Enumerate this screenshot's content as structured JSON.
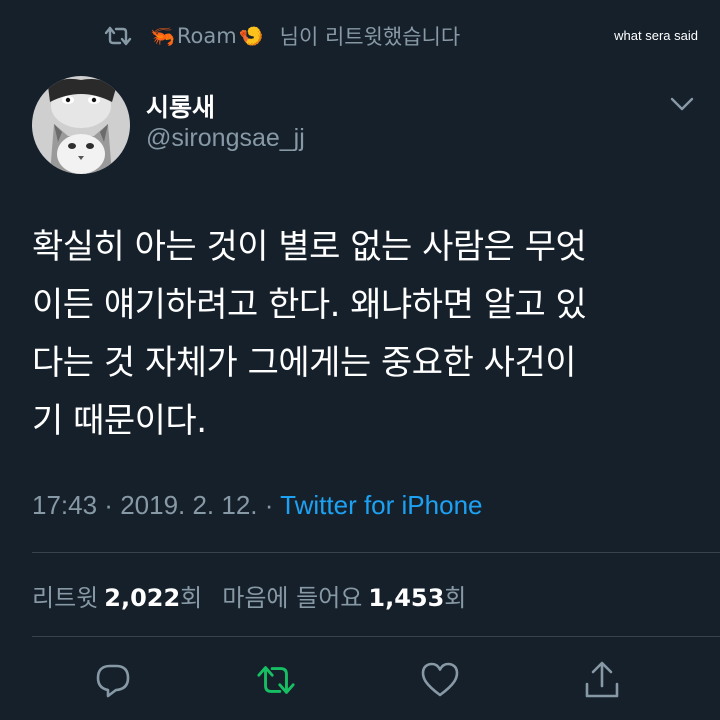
{
  "watermark": "what sera said",
  "retweet_context": {
    "prefix_emoji": "🦐",
    "name": "Roam",
    "suffix_emoji": "🍤",
    "text": "님이 리트윗했습니다"
  },
  "author": {
    "display_name": "시롱새",
    "handle": "@sirongsae_jj"
  },
  "tweet": {
    "lines": [
      "확실히 아는 것이 별로 없는 사람은 무엇",
      "이든 얘기하려고 한다. 왜냐하면 알고 있",
      "다는 것 자체가 그에게는 중요한 사건이",
      "기 때문이다."
    ]
  },
  "meta": {
    "time": "17:43",
    "separator": " · ",
    "date": "2019. 2. 12.",
    "source": "Twitter for iPhone"
  },
  "stats": {
    "retweets_label": "리트윗",
    "retweets_count": "2,022",
    "retweets_unit": "회",
    "likes_label": "마음에 들어요",
    "likes_count": "1,453",
    "likes_unit": "회"
  },
  "colors": {
    "background": "#15202b",
    "secondary_text": "#8899a6",
    "link": "#1da1f2",
    "retweeted_green": "#17bf63",
    "divider": "#38444d"
  },
  "icons": {
    "retweet_context": "retweet-icon",
    "menu": "chevron-down-icon",
    "reply": "reply-icon",
    "retweet": "retweet-icon",
    "like": "heart-icon",
    "share": "share-icon"
  }
}
